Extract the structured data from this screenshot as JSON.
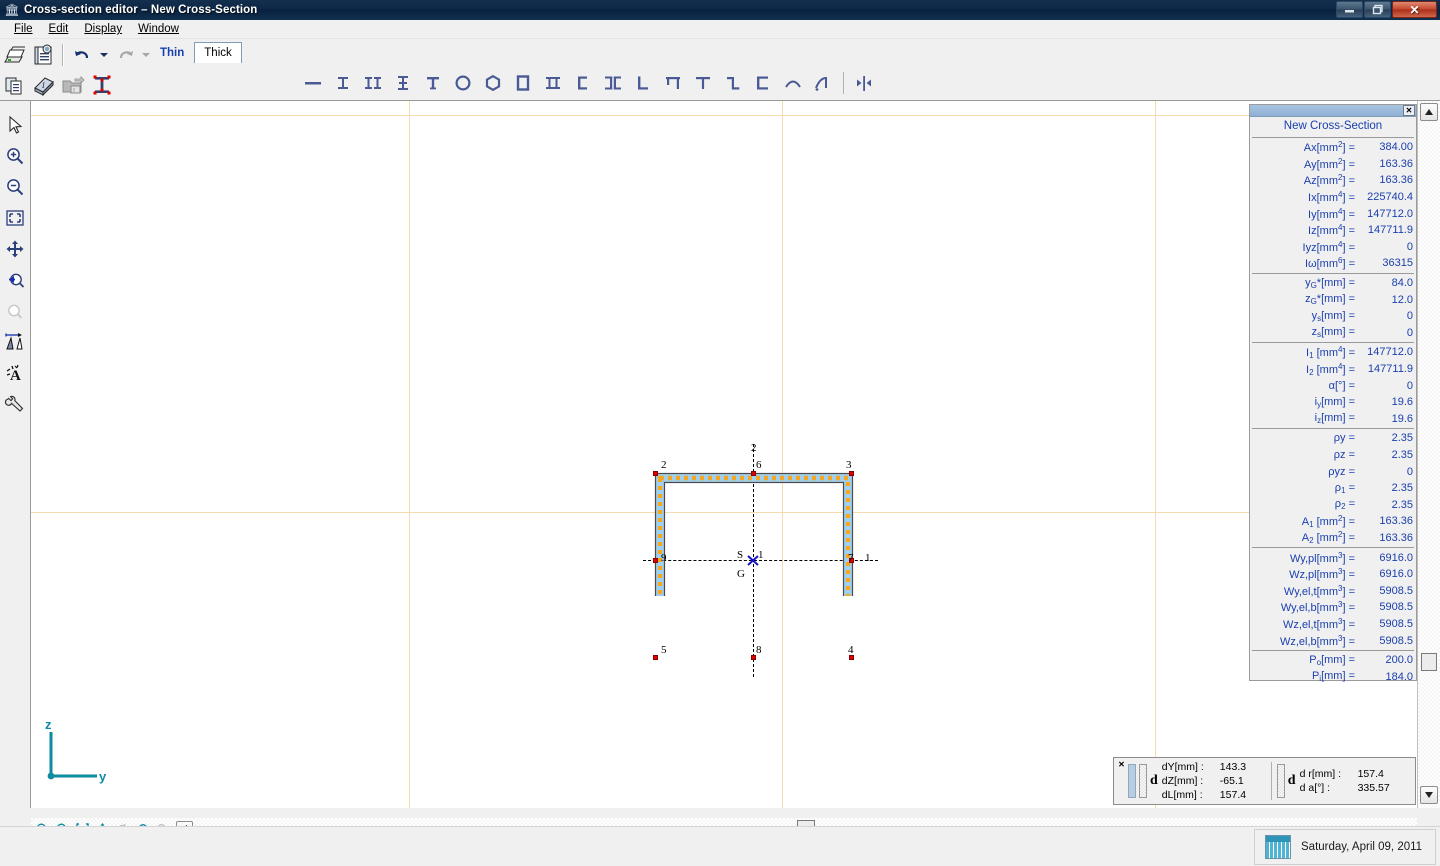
{
  "window": {
    "title": "Cross-section editor – New Cross-Section",
    "icon": "app-icon",
    "minimize": "–",
    "maximize": "❐",
    "close": "✕"
  },
  "menubar": {
    "items": [
      {
        "label": "File",
        "accel": "F"
      },
      {
        "label": "Edit",
        "accel": "E"
      },
      {
        "label": "Display",
        "accel": "D"
      },
      {
        "label": "Window",
        "accel": "W"
      }
    ]
  },
  "toolbar": {
    "row1": [
      {
        "name": "print-icon",
        "label": "Print"
      },
      {
        "name": "print-preview-icon",
        "label": "Print Preview"
      },
      {
        "name": "undo-icon",
        "label": "Undo"
      },
      {
        "name": "undo-dropdown-icon",
        "label": "Undo History"
      },
      {
        "name": "redo-icon",
        "label": "Redo"
      },
      {
        "name": "redo-dropdown-icon",
        "label": "Redo History"
      }
    ],
    "row2": [
      {
        "name": "copy-icon",
        "label": "Copy"
      },
      {
        "name": "library-icon",
        "label": "Section Library"
      },
      {
        "name": "open-section-icon",
        "label": "Open Section"
      },
      {
        "name": "i-section-icon",
        "label": "I-Section"
      }
    ]
  },
  "tabs": [
    {
      "label": "Thin",
      "active": true
    },
    {
      "label": "Thick",
      "active": false
    }
  ],
  "shapebar": {
    "shapes": [
      {
        "name": "plate-shape-icon",
        "glyph": "flat"
      },
      {
        "name": "i-beam-shape-icon",
        "glyph": "ibeam"
      },
      {
        "name": "double-i-shape-icon",
        "glyph": "doublei"
      },
      {
        "name": "i-variant-shape-icon",
        "glyph": "ivar"
      },
      {
        "name": "t-beam-shape-icon",
        "glyph": "tbeam"
      },
      {
        "name": "circle-hollow-shape-icon",
        "glyph": "circle"
      },
      {
        "name": "hexagon-shape-icon",
        "glyph": "hex"
      },
      {
        "name": "rect-hollow-shape-icon",
        "glyph": "rect"
      },
      {
        "name": "double-t-shape-icon",
        "glyph": "doublet"
      },
      {
        "name": "channel-shape-icon",
        "glyph": "channel"
      },
      {
        "name": "double-channel-shape-icon",
        "glyph": "dchannel"
      },
      {
        "name": "angle-shape-icon",
        "glyph": "angle"
      },
      {
        "name": "hat-shape-icon",
        "glyph": "hat"
      },
      {
        "name": "tee-shape-icon",
        "glyph": "tee"
      },
      {
        "name": "zed-shape-icon",
        "glyph": "zed"
      },
      {
        "name": "c-shape-icon",
        "glyph": "cshape"
      },
      {
        "name": "arc-shape-icon",
        "glyph": "arc"
      },
      {
        "name": "polyline-shape-icon",
        "glyph": "polyline"
      },
      {
        "name": "mirror-shape-icon",
        "glyph": "mirror"
      }
    ]
  },
  "vertical_toolbar": {
    "items": [
      {
        "name": "select-arrow-icon",
        "label": "Select"
      },
      {
        "name": "zoom-in-icon",
        "label": "Zoom In"
      },
      {
        "name": "zoom-out-icon",
        "label": "Zoom Out"
      },
      {
        "name": "zoom-fit-icon",
        "label": "Zoom to Fit"
      },
      {
        "name": "pan-icon",
        "label": "Pan"
      },
      {
        "name": "zoom-previous-icon",
        "label": "Previous View"
      },
      {
        "name": "zoom-next-icon",
        "label": "Next View"
      },
      {
        "name": "dimension-icon",
        "label": "Dimension"
      },
      {
        "name": "text-annotation-icon",
        "label": "Annotation"
      },
      {
        "name": "settings-wrench-icon",
        "label": "Settings"
      }
    ]
  },
  "canvas": {
    "axis": {
      "z_label": "z",
      "y_label": "y"
    },
    "section_name": "New Cross-Section",
    "node_labels": [
      "2",
      "6",
      "3",
      "9",
      "1",
      "7",
      "5",
      "8",
      "4"
    ],
    "axis_labels": {
      "vertical": "2",
      "horizontal": "1"
    },
    "centroid_label": "G",
    "shear_center_label": "S",
    "center_node_label": "1",
    "bottom_left_node": "5",
    "bottom_mid_node": "8",
    "bottom_right_node": "4",
    "right_node": "7",
    "left_node": "9",
    "top_left_node": "2",
    "top_mid_node": "6",
    "top_right_node": "3",
    "right_axis_label": "1"
  },
  "properties": {
    "title": "New Cross-Section",
    "close": "✕",
    "groups": [
      {
        "rows": [
          {
            "label": "Ax[mm",
            "sup": "2",
            "tail": "] =",
            "value": "384.00"
          },
          {
            "label": "Ay[mm",
            "sup": "2",
            "tail": "] =",
            "value": "163.36"
          },
          {
            "label": "Az[mm",
            "sup": "2",
            "tail": "] =",
            "value": "163.36"
          },
          {
            "label": "Ix[mm",
            "sup": "4",
            "tail": "] =",
            "value": "225740.4"
          },
          {
            "label": "Iy[mm",
            "sup": "4",
            "tail": "] =",
            "value": "147712.0"
          },
          {
            "label": "Iz[mm",
            "sup": "4",
            "tail": "] =",
            "value": "147711.9"
          },
          {
            "label": "Iyz[mm",
            "sup": "4",
            "tail": "] =",
            "value": "0"
          },
          {
            "label": "Iω[mm",
            "sup": "6",
            "tail": "] =",
            "value": "36315"
          }
        ]
      },
      {
        "rows": [
          {
            "label": "y",
            "sub": "G",
            "tail": "*[mm] =",
            "value": "84.0"
          },
          {
            "label": "z",
            "sub": "G",
            "tail": "*[mm] =",
            "value": "12.0"
          },
          {
            "label": "y",
            "sub": "s",
            "tail": "[mm] =",
            "value": "0"
          },
          {
            "label": "z",
            "sub": "s",
            "tail": "[mm] =",
            "value": "0"
          }
        ]
      },
      {
        "rows": [
          {
            "label": "I",
            "sub": "1",
            "tail": " [mm",
            "sup": "4",
            "tail2": "] =",
            "value": "147712.0"
          },
          {
            "label": "I",
            "sub": "2",
            "tail": " [mm",
            "sup": "4",
            "tail2": "] =",
            "value": "147711.9"
          },
          {
            "label": "α[°] =",
            "value": "0"
          },
          {
            "label": "i",
            "sub": "y",
            "tail": "[mm] =",
            "value": "19.6"
          },
          {
            "label": "i",
            "sub": "z",
            "tail": "[mm] =",
            "value": "19.6"
          }
        ]
      },
      {
        "rows": [
          {
            "label": "ρy =",
            "value": "2.35"
          },
          {
            "label": "ρz =",
            "value": "2.35"
          },
          {
            "label": "ρyz =",
            "value": "0"
          },
          {
            "label": "ρ",
            "sub": "1",
            "tail": " =",
            "value": "2.35"
          },
          {
            "label": "ρ",
            "sub": "2",
            "tail": " =",
            "value": "2.35"
          },
          {
            "label": "A",
            "sub": "1",
            "tail": " [mm",
            "sup": "2",
            "tail2": "] =",
            "value": "163.36"
          },
          {
            "label": "A",
            "sub": "2",
            "tail": " [mm",
            "sup": "2",
            "tail2": "] =",
            "value": "163.36"
          }
        ]
      },
      {
        "rows": [
          {
            "label": "Wy,pl[mm",
            "sup": "3",
            "tail": "] =",
            "value": "6916.0"
          },
          {
            "label": "Wz,pl[mm",
            "sup": "3",
            "tail": "] =",
            "value": "6916.0"
          },
          {
            "label": "Wy,el,t[mm",
            "sup": "3",
            "tail": "] =",
            "value": "5908.5"
          },
          {
            "label": "Wy,el,b[mm",
            "sup": "3",
            "tail": "] =",
            "value": "5908.5"
          },
          {
            "label": "Wz,el,t[mm",
            "sup": "3",
            "tail": "] =",
            "value": "5908.5"
          },
          {
            "label": "Wz,el,b[mm",
            "sup": "3",
            "tail": "] =",
            "value": "5908.5"
          }
        ]
      },
      {
        "rows": [
          {
            "label": "P",
            "sub": "o",
            "tail": "[mm] =",
            "value": "200.0"
          },
          {
            "label": "P",
            "sub": "i",
            "tail": "[mm] =",
            "value": "184.0"
          }
        ]
      }
    ]
  },
  "coord_panel": {
    "close": "✕",
    "group1_prefix": "d",
    "group1": [
      {
        "key": "dY[mm] :",
        "value": "143.3"
      },
      {
        "key": "dZ[mm] :",
        "value": "-65.1"
      },
      {
        "key": "dL[mm] :",
        "value": "157.4"
      }
    ],
    "group2_prefix": "d",
    "group2": [
      {
        "key": "d r[mm] :",
        "value": "157.4"
      },
      {
        "key": "d    a[°] :",
        "value": "335.57"
      }
    ]
  },
  "statusbar": {
    "date": "Saturday, April 09, 2011",
    "calendar_icon": "calendar-icon"
  },
  "zoombar": {
    "items": [
      {
        "name": "zoom-in-small-icon"
      },
      {
        "name": "zoom-out-small-icon"
      },
      {
        "name": "zoom-fit-small-icon"
      },
      {
        "name": "pan-small-icon"
      },
      {
        "name": "rotate-left-small-icon"
      },
      {
        "name": "zoom-prev-small-icon"
      },
      {
        "name": "zoom-next-small-icon"
      },
      {
        "name": "collapse-small-icon"
      }
    ]
  },
  "colors": {
    "accent_blue": "#1a3fae",
    "title_bar": "#0d2746",
    "grid": "#f5dcae",
    "node_red": "#e00000",
    "wall_fill": "#9fd0ef",
    "wall_center": "#f5a623",
    "axis_teal": "#0d8ba1"
  }
}
